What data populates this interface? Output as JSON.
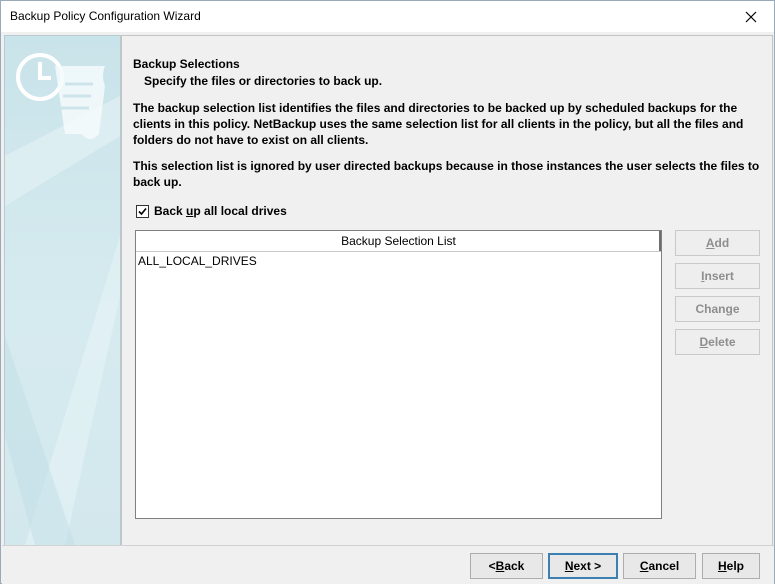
{
  "window": {
    "title": "Backup Policy Configuration Wizard"
  },
  "page": {
    "heading": "Backup Selections",
    "subheading": "Specify the files or directories to back up.",
    "description1": "The backup selection list identifies the files and directories to be backed up by scheduled backups for the clients in this policy. NetBackup uses the same selection list for all clients in the policy, but all the files and folders do not have to exist on all clients.",
    "description2": "This selection list is ignored by user directed backups because in those instances the user selects the files to back up."
  },
  "checkbox": {
    "label_pre": "Back ",
    "label_mnemonic": "u",
    "label_post": "p all local drives",
    "checked": true
  },
  "list": {
    "header": "Backup Selection List",
    "items": [
      "ALL_LOCAL_DRIVES"
    ]
  },
  "side_buttons": [
    {
      "pre": "",
      "mn": "A",
      "post": "dd",
      "enabled": false
    },
    {
      "pre": "",
      "mn": "I",
      "post": "nsert",
      "enabled": false
    },
    {
      "pre": "Chan",
      "mn": "g",
      "post": "e",
      "enabled": false
    },
    {
      "pre": "",
      "mn": "D",
      "post": "elete",
      "enabled": false
    }
  ],
  "footer": {
    "back": {
      "pre": "< ",
      "mn": "B",
      "post": "ack"
    },
    "next": {
      "pre": "",
      "mn": "N",
      "post": "ext >"
    },
    "cancel": {
      "pre": "",
      "mn": "C",
      "post": "ancel"
    },
    "help": {
      "pre": "",
      "mn": "H",
      "post": "elp"
    }
  },
  "icons": {
    "close": "close-icon",
    "wizard_art": "clock-scroll-icon",
    "check": "check-icon"
  }
}
